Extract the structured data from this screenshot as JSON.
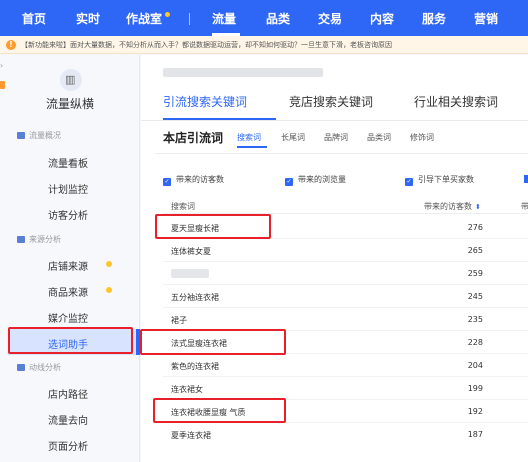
{
  "topnav": {
    "items": [
      {
        "label": "首页",
        "active": false
      },
      {
        "label": "实时",
        "active": false
      },
      {
        "label": "作战室",
        "active": false,
        "badge": true
      },
      {
        "label": "流量",
        "active": true
      },
      {
        "label": "品类",
        "active": false
      },
      {
        "label": "交易",
        "active": false
      },
      {
        "label": "内容",
        "active": false
      },
      {
        "label": "服务",
        "active": false
      },
      {
        "label": "营销",
        "active": false
      }
    ],
    "accent": "#2e67f6"
  },
  "notice": {
    "text": "【新功能来啦】面对大量数据，不知分析从而入手？都说数据驱动运营，却不知如何驱动？一旦生意下滑，老板咨询原因"
  },
  "sidebar": {
    "app_title": "流量纵横",
    "groups": [
      {
        "title": "流量概况",
        "items": [
          {
            "label": "流量看板"
          },
          {
            "label": "计划监控"
          },
          {
            "label": "访客分析"
          }
        ]
      },
      {
        "title": "来源分析",
        "items": [
          {
            "label": "店铺来源",
            "dot": true
          },
          {
            "label": "商品来源",
            "dot": true
          },
          {
            "label": "媒介监控"
          },
          {
            "label": "选词助手",
            "active": true
          }
        ]
      },
      {
        "title": "动线分析",
        "items": [
          {
            "label": "店内路径"
          },
          {
            "label": "流量去向"
          },
          {
            "label": "页面分析"
          }
        ]
      }
    ]
  },
  "main": {
    "tabs": [
      {
        "label": "引流搜索关键词",
        "active": true
      },
      {
        "label": "竞店搜索关键词",
        "active": false
      },
      {
        "label": "行业相关搜索词",
        "active": false
      }
    ],
    "section_title": "本店引流词",
    "subtabs": [
      {
        "label": "搜索词",
        "active": true
      },
      {
        "label": "长尾词",
        "active": false
      },
      {
        "label": "品牌词",
        "active": false
      },
      {
        "label": "品类词",
        "active": false
      },
      {
        "label": "修饰词",
        "active": false
      }
    ],
    "checks": [
      "带来的访客数",
      "带来的浏览量",
      "引导下单买家数"
    ],
    "columns": [
      "搜索词",
      "带来的访客数",
      "带"
    ],
    "rows": [
      {
        "keyword": "夏天显瘦长裙",
        "visitors": "276",
        "highlight": true
      },
      {
        "keyword": "连体裤女夏",
        "visitors": "265",
        "highlight": false
      },
      {
        "keyword": "",
        "visitors": "259",
        "highlight": false,
        "blurred": true
      },
      {
        "keyword": "五分袖连衣裙",
        "visitors": "245",
        "highlight": false
      },
      {
        "keyword": "裙子",
        "visitors": "235",
        "highlight": false
      },
      {
        "keyword": "法式显瘦连衣裙",
        "visitors": "228",
        "highlight": true
      },
      {
        "keyword": "紫色的连衣裙",
        "visitors": "204",
        "highlight": false
      },
      {
        "keyword": "连衣裙女",
        "visitors": "199",
        "highlight": false
      },
      {
        "keyword": "连衣裙收腰显瘦 气质",
        "visitors": "192",
        "highlight": true
      },
      {
        "keyword": "夏季连衣裙",
        "visitors": "187",
        "highlight": false
      }
    ]
  }
}
